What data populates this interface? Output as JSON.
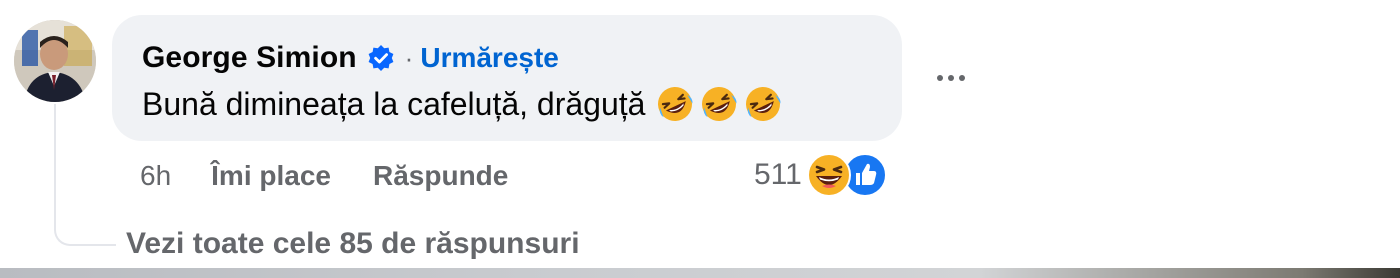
{
  "comment": {
    "author": {
      "name": "George Simion",
      "verified_icon": "verified-badge-icon",
      "separator": "·",
      "follow_label": "Urmărește"
    },
    "text": "Bună dimineața la cafeluță, drăguță",
    "inline_emojis": [
      "rolling-on-floor-laughing-icon",
      "rolling-on-floor-laughing-icon",
      "rolling-on-floor-laughing-icon"
    ],
    "time": "6h",
    "like_label": "Îmi place",
    "reply_label": "Răspunde",
    "reactions": {
      "count": "511",
      "icons": [
        "haha-reaction-icon",
        "like-reaction-icon"
      ]
    },
    "more_icon": "more-options-icon",
    "view_replies_label": "Vezi toate cele 85 de răspunsuri"
  },
  "colors": {
    "bubble": "#f0f2f5",
    "name": "#050505",
    "follow": "#0064d1",
    "secondary": "#65676b",
    "like_blue": "#1877f2",
    "haha_yellow": "#f7b125"
  }
}
